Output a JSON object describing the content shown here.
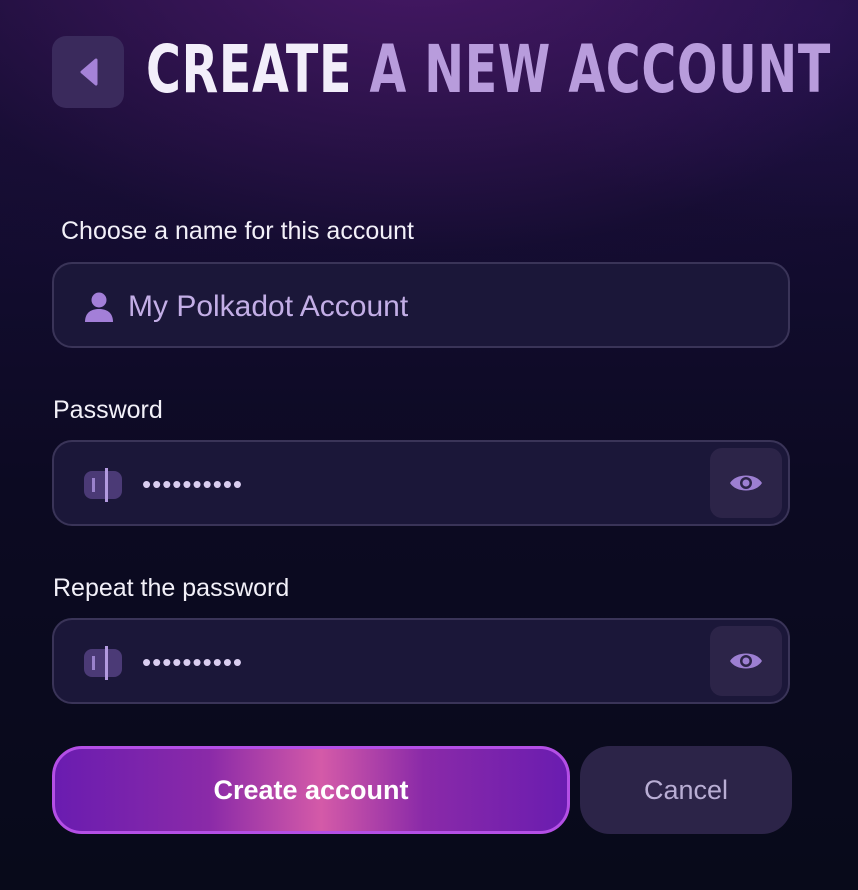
{
  "header": {
    "title_part1": "CREATE",
    "title_part2": "A NEW ACCOUNT",
    "back_icon": "chevron-left-icon"
  },
  "form": {
    "name_label": "Choose a name for this account",
    "name_value": "My Polkadot Account",
    "name_icon": "user-icon",
    "password_label": "Password",
    "password_value": "••••••••••",
    "repeat_label": "Repeat the password",
    "repeat_value": "••••••••••",
    "key_icon": "key-icon",
    "reveal_icon": "eye-icon"
  },
  "actions": {
    "create_label": "Create account",
    "cancel_label": "Cancel"
  },
  "colors": {
    "accent": "#b44fe6",
    "title_primary": "#f2eefa",
    "title_secondary": "#b89cdc",
    "input_bg": "#1b1739"
  }
}
